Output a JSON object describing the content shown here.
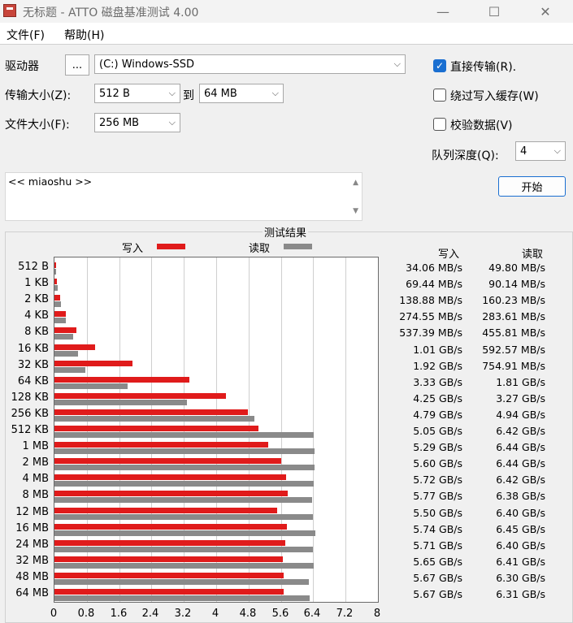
{
  "window": {
    "title": "无标题 - ATTO 磁盘基准测试 4.00",
    "minimize": "—",
    "maximize": "☐",
    "close": "✕"
  },
  "menu": {
    "file": "文件(F)",
    "help": "帮助(H)"
  },
  "controls": {
    "drive_label": "驱动器",
    "browse_label": "...",
    "drive_value": "(C:) Windows-SSD",
    "transfer_label": "传输大小(Z):",
    "transfer_from": "512 B",
    "transfer_to_label": "到",
    "transfer_to": "64 MB",
    "file_size_label": "文件大小(F):",
    "file_size": "256 MB",
    "direct_io_label": "直接传输(R).",
    "bypass_cache_label": "绕过写入缓存(W)",
    "verify_label": "校验数据(V)",
    "queue_label": "队列深度(Q):",
    "queue_value": "4",
    "start_label": "开始"
  },
  "description": "<< miaoshu >>",
  "results": {
    "title": "测试结果",
    "legend_write": "写入",
    "legend_read": "读取",
    "col_write": "写入",
    "col_read": "读取",
    "colors": {
      "write": "#e01b1b",
      "read": "#8a8a8a"
    }
  },
  "chart_data": {
    "type": "bar",
    "orientation": "horizontal",
    "title": "测试结果",
    "xlim": [
      0,
      8
    ],
    "x_ticks": [
      "0",
      "0.8",
      "1.6",
      "2.4",
      "3.2",
      "4",
      "4.8",
      "5.6",
      "6.4",
      "7.2",
      "8"
    ],
    "categories": [
      "512 B",
      "1 KB",
      "2 KB",
      "4 KB",
      "8 KB",
      "16 KB",
      "32 KB",
      "64 KB",
      "128 KB",
      "256 KB",
      "512 KB",
      "1 MB",
      "2 MB",
      "4 MB",
      "8 MB",
      "12 MB",
      "16 MB",
      "24 MB",
      "32 MB",
      "48 MB",
      "64 MB"
    ],
    "series": [
      {
        "name": "写入",
        "values_gbps": [
          0.03406,
          0.06944,
          0.13888,
          0.27455,
          0.53739,
          1.01,
          1.92,
          3.33,
          4.25,
          4.79,
          5.05,
          5.29,
          5.6,
          5.72,
          5.77,
          5.5,
          5.74,
          5.71,
          5.65,
          5.67,
          5.67
        ],
        "labels": [
          "34.06 MB/s",
          "69.44 MB/s",
          "138.88 MB/s",
          "274.55 MB/s",
          "537.39 MB/s",
          "1.01 GB/s",
          "1.92 GB/s",
          "3.33 GB/s",
          "4.25 GB/s",
          "4.79 GB/s",
          "5.05 GB/s",
          "5.29 GB/s",
          "5.60 GB/s",
          "5.72 GB/s",
          "5.77 GB/s",
          "5.50 GB/s",
          "5.74 GB/s",
          "5.71 GB/s",
          "5.65 GB/s",
          "5.67 GB/s",
          "5.67 GB/s"
        ]
      },
      {
        "name": "读取",
        "values_gbps": [
          0.0498,
          0.09014,
          0.16023,
          0.28361,
          0.45581,
          0.59257,
          0.75491,
          1.81,
          3.27,
          4.94,
          6.42,
          6.44,
          6.44,
          6.42,
          6.38,
          6.4,
          6.45,
          6.4,
          6.41,
          6.3,
          6.31
        ],
        "labels": [
          "49.80 MB/s",
          "90.14 MB/s",
          "160.23 MB/s",
          "283.61 MB/s",
          "455.81 MB/s",
          "592.57 MB/s",
          "754.91 MB/s",
          "1.81 GB/s",
          "3.27 GB/s",
          "4.94 GB/s",
          "6.42 GB/s",
          "6.44 GB/s",
          "6.44 GB/s",
          "6.42 GB/s",
          "6.38 GB/s",
          "6.40 GB/s",
          "6.45 GB/s",
          "6.40 GB/s",
          "6.41 GB/s",
          "6.30 GB/s",
          "6.31 GB/s"
        ]
      }
    ]
  }
}
